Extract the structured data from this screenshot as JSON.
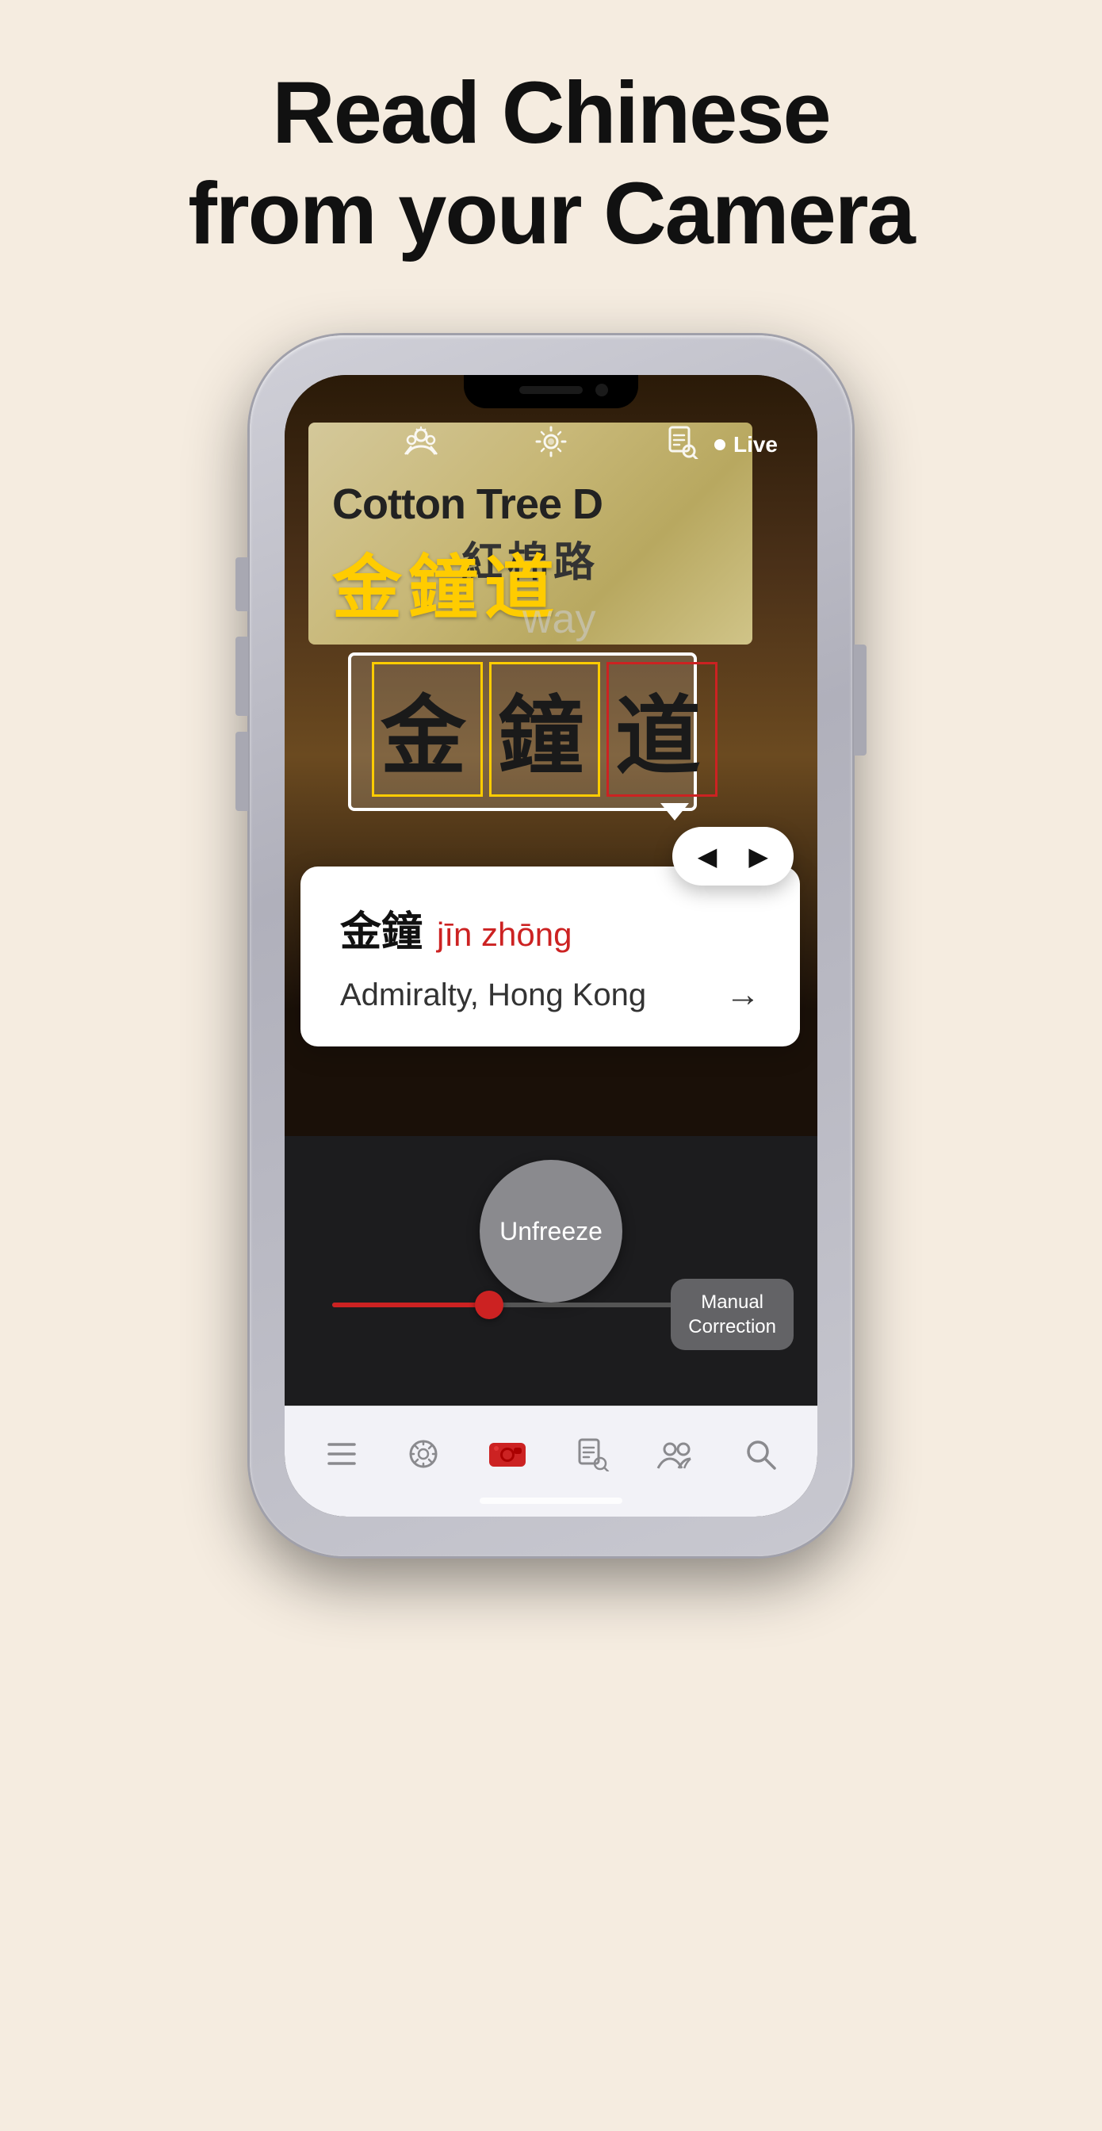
{
  "page": {
    "title_line1": "Read Chinese",
    "title_line2": "from your Camera"
  },
  "camera": {
    "live_label": "Live",
    "street_sign_english": "Cotton Tree D",
    "street_sign_chinese": "紅棉路",
    "overlay_yellow": "金鐘道",
    "overlay_sub": "Gateway",
    "selection_chars": [
      "金",
      "鐘",
      "道"
    ]
  },
  "toolbar": {
    "icon1": "🌐",
    "icon2": "✦",
    "icon3": "📋"
  },
  "nav_arrows": {
    "left": "◀",
    "right": "▶"
  },
  "translation": {
    "chars": "金鐘",
    "pinyin": "jīn zhōng",
    "meaning": "Admiralty, Hong Kong"
  },
  "controls": {
    "unfreeze_label": "Unfreeze",
    "manual_correction_label": "Manual\nCorrection"
  },
  "tabs": [
    {
      "icon": "☰",
      "label": "",
      "active": false
    },
    {
      "icon": "✿",
      "label": "",
      "active": false
    },
    {
      "icon": "🎥",
      "label": "",
      "active": true
    },
    {
      "icon": "📋",
      "label": "",
      "active": false
    },
    {
      "icon": "👥",
      "label": "",
      "active": false
    },
    {
      "icon": "🔍",
      "label": "",
      "active": false
    }
  ],
  "colors": {
    "accent": "#cc2222",
    "background": "#f5ece0",
    "yellow_char": "#ffcc00"
  }
}
